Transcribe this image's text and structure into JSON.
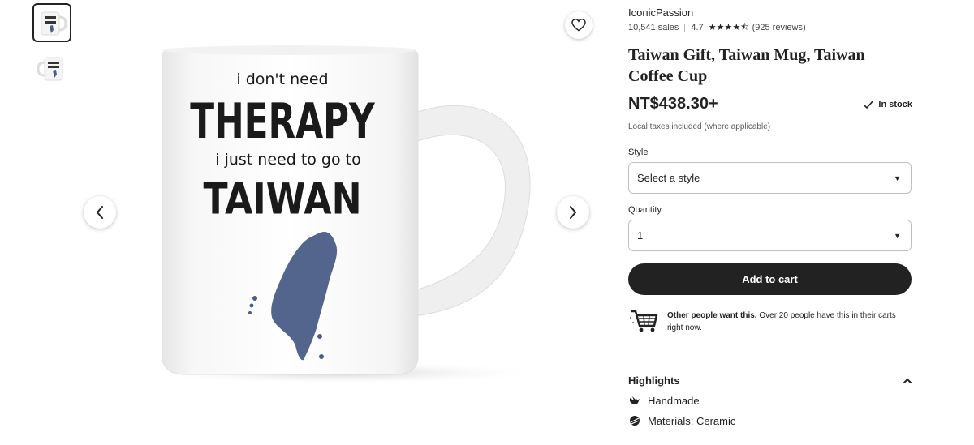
{
  "gallery": {
    "thumbnails": [
      {
        "alt": "mug-front",
        "active": true
      },
      {
        "alt": "mug-side",
        "active": false
      }
    ],
    "mug_text": {
      "line1": "i don't need",
      "line2": "THERAPY",
      "line3": "i just need to go to",
      "line4": "TAIWAN"
    },
    "icons": {
      "favorite": "heart-icon",
      "prev": "chevron-left-icon",
      "next": "chevron-right-icon"
    }
  },
  "shop": {
    "name": "IconicPassion",
    "sales": "10,541 sales",
    "rating": "4.7",
    "reviews": "(925 reviews)",
    "stars_filled": 4.5
  },
  "listing": {
    "title": "Taiwan Gift, Taiwan Mug, Taiwan Coffee Cup",
    "price": "NT$438.30+",
    "stock": "In stock",
    "tax_note": "Local taxes included (where applicable)"
  },
  "options": {
    "style_label": "Style",
    "style_value": "Select a style",
    "quantity_label": "Quantity",
    "quantity_value": "1"
  },
  "cart": {
    "button_label": "Add to cart"
  },
  "promo": {
    "bold": "Other people want this.",
    "text": " Over 20 people have this in their carts right now."
  },
  "highlights": {
    "title": "Highlights",
    "items": [
      {
        "icon": "hand-icon",
        "label": "Handmade"
      },
      {
        "icon": "materials-icon",
        "label": "Materials: Ceramic"
      }
    ]
  },
  "colors": {
    "primary": "#222222",
    "map_blue": "#4a5d87"
  }
}
